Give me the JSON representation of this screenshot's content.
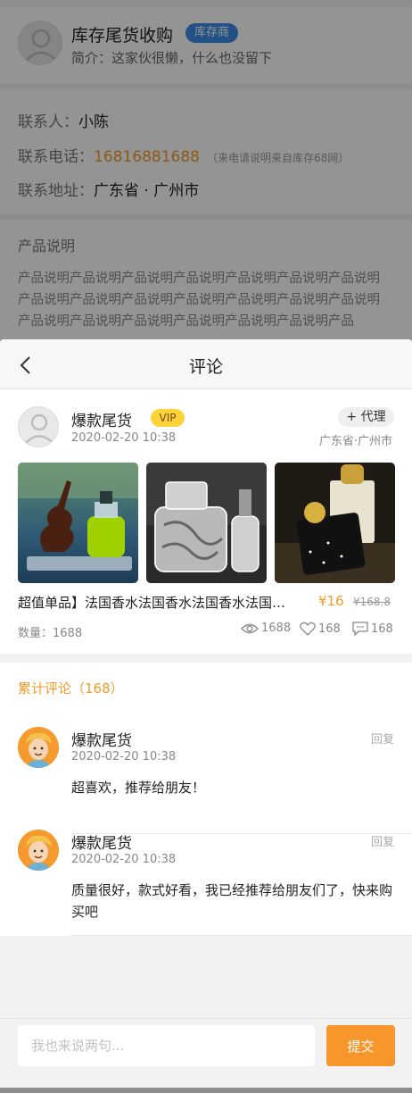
{
  "shop": {
    "name": "库存尾货收购",
    "badge": "库存商",
    "intro": "简介：这家伙很懒，什么也没留下"
  },
  "contact": {
    "person_label": "联系人：",
    "person": "小陈",
    "phone_label": "联系电话：",
    "phone": "16816881688",
    "phone_note": "（来电请说明来自库存68网）",
    "address_label": "联系地址：",
    "address": "广东省 · 广州市"
  },
  "product_desc": {
    "title": "产品说明",
    "text": "产品说明产品说明产品说明产品说明产品说明产品说明产品说明产品说明产品说明产品说明产品说明产品说明产品说明产品说明产品说明产品说明产品说明产品说明产品说明产品说明产品"
  },
  "sheet": {
    "title": "评论"
  },
  "post": {
    "author": "爆款尾货",
    "vip": "VIP",
    "time": "2020-02-20 10:38",
    "agent_button": "+ 代理",
    "location": "广东省·广州市",
    "title": "超值单品】法国香水法国香水法国香水法国香水法国香水",
    "price": "¥16",
    "old_price": "¥168.8",
    "quantity": "数量：1688",
    "views": "1688",
    "likes": "168",
    "comments": "168"
  },
  "comments": {
    "title": "累计评论（168）",
    "reply_label": "回复",
    "items": [
      {
        "name": "爆款尾货",
        "time": "2020-02-20 10:38",
        "text": "超喜欢，推荐给朋友！"
      },
      {
        "name": "爆款尾货",
        "time": "2020-02-20 10:38",
        "text": "质量很好，款式好看，我已经推荐给朋友们了，快来购买吧"
      }
    ]
  },
  "footer": {
    "placeholder": "我也来说两句...",
    "submit": "提交"
  },
  "colors": {
    "accent": "#f7962a",
    "badge_blue": "#3b8ee6",
    "vip_yellow": "#ffd23a"
  }
}
